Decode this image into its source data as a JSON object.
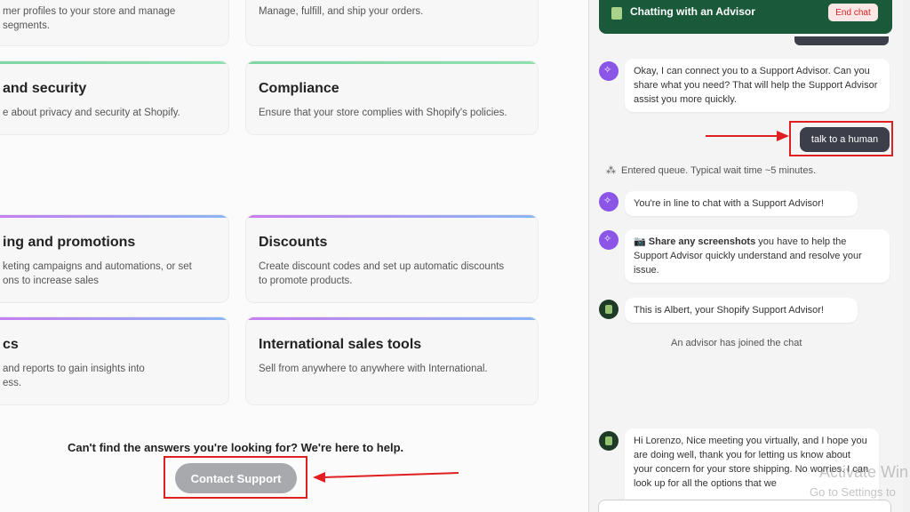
{
  "help_center": {
    "top_cards": [
      {
        "desc": "mer profiles to your store and manage\nsegments."
      },
      {
        "desc": "Manage, fulfill, and ship your orders."
      }
    ],
    "cards": [
      {
        "title": "and security",
        "desc": "e about privacy and security at Shopify."
      },
      {
        "title": "Compliance",
        "desc": "Ensure that your store complies with Shopify's policies."
      },
      {
        "title": "ing and promotions",
        "desc": "keting campaigns and automations, or set\nons to increase sales"
      },
      {
        "title": "Discounts",
        "desc": "Create discount codes and set up automatic discounts\nto promote products."
      },
      {
        "title": "cs",
        "desc": "and reports to gain insights into\ness."
      },
      {
        "title": "International sales tools",
        "desc": "Sell from anywhere to anywhere with International."
      }
    ],
    "help_text": "Can't find the answers you're looking for? We're here to help.",
    "contact_button": "Contact Support"
  },
  "chat": {
    "header_title": "Chatting with an Advisor",
    "end_chat": "End chat",
    "messages": [
      {
        "text": "Okay, I can connect you to a Support Advisor. Can you share what you need? That will help the Support Advisor assist you more quickly."
      },
      {
        "text": "talk to a human"
      },
      {
        "text": "Entered queue. Typical wait time ~5 minutes."
      },
      {
        "text": "You're in line to chat with a Support Advisor!"
      },
      {
        "bold": "Share any screenshots",
        "text": " you have to help the Support Advisor quickly understand and resolve your issue."
      },
      {
        "text": "This is Albert, your Shopify Support Advisor!"
      },
      {
        "text": "An advisor has joined the chat"
      },
      {
        "text": "Hi Lorenzo, Nice meeting you virtually, and I hope you are doing well, thank you for letting us know about your concern for your store shipping. No worries. I can look up for all the options that we"
      }
    ]
  },
  "watermark": {
    "line1": "Activate Win",
    "line2": "Go to Settings to"
  },
  "colors": {
    "header": "#1a5a3b",
    "annotation_red": "#e02020",
    "bot_avatar": "#8b55e8"
  },
  "icons": [
    "shopping-bag-icon",
    "sparkle-icon",
    "queue-icon",
    "camera-icon",
    "arrow-icon"
  ]
}
